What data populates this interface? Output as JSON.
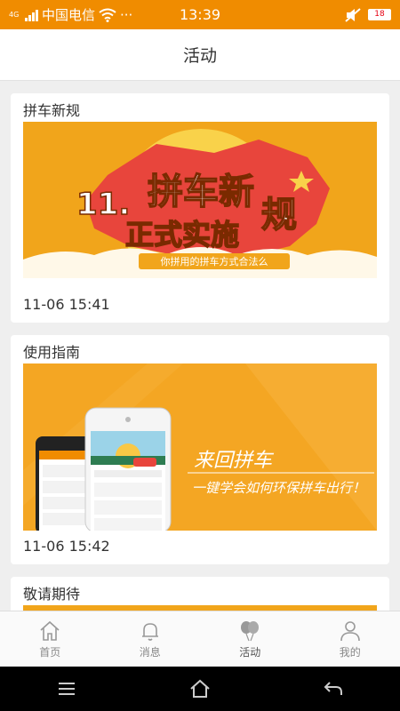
{
  "status_bar": {
    "network_type": "4G",
    "carrier": "中国电信",
    "more": "···",
    "time": "13:39",
    "battery": "18"
  },
  "app_bar": {
    "title": "活动"
  },
  "cards": [
    {
      "title": "拼车新规",
      "banner": {
        "headline_prefix": "11.",
        "headline": "拼车新",
        "headline_end": "规",
        "subheadline": "正式实施",
        "caption": "你拼用的拼车方式合法么"
      },
      "date": "11-06 15:41"
    },
    {
      "title": "使用指南",
      "banner": {
        "headline": "来回拼车",
        "subheadline": "一键学会如何环保拼车出行！"
      },
      "date": "11-06 15:42"
    },
    {
      "title": "敬请期待"
    }
  ],
  "bottom_nav": {
    "items": [
      {
        "label": "首页",
        "icon": "home-icon"
      },
      {
        "label": "消息",
        "icon": "bell-icon"
      },
      {
        "label": "活动",
        "icon": "balloons-icon",
        "active": true
      },
      {
        "label": "我的",
        "icon": "person-icon"
      }
    ]
  },
  "system_nav": {
    "icons": [
      "menu-icon",
      "home-outline-icon",
      "back-icon"
    ]
  },
  "colors": {
    "accent": "#f08c00",
    "banner_orange": "#f1a51b",
    "banner_red": "#e8453c",
    "active_icon": "#999999"
  }
}
